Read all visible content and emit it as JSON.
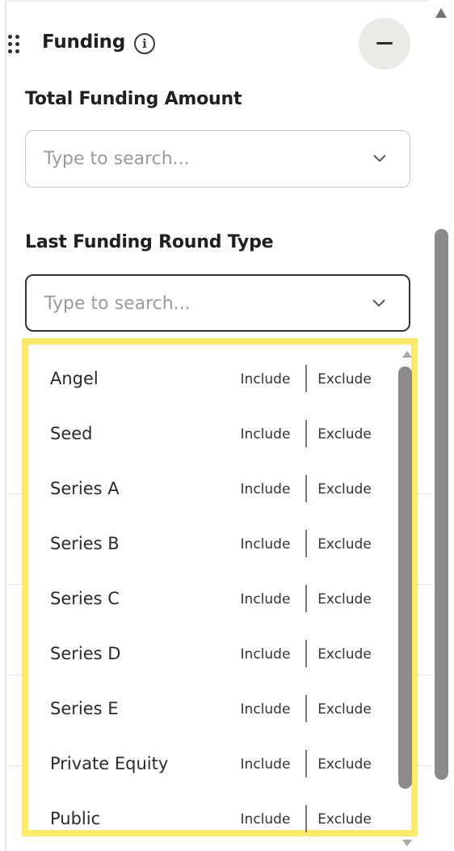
{
  "section": {
    "title": "Funding",
    "info_glyph": "i",
    "collapse_icon": "minus-icon"
  },
  "total_funding": {
    "label": "Total Funding Amount",
    "placeholder": "Type to search..."
  },
  "last_round": {
    "label": "Last Funding Round Type",
    "placeholder": "Type to search..."
  },
  "dropdown": {
    "highlight_color": "#fbe96b",
    "options": [
      {
        "label": "Angel",
        "include": "Include",
        "exclude": "Exclude"
      },
      {
        "label": "Seed",
        "include": "Include",
        "exclude": "Exclude"
      },
      {
        "label": "Series A",
        "include": "Include",
        "exclude": "Exclude"
      },
      {
        "label": "Series B",
        "include": "Include",
        "exclude": "Exclude"
      },
      {
        "label": "Series C",
        "include": "Include",
        "exclude": "Exclude"
      },
      {
        "label": "Series D",
        "include": "Include",
        "exclude": "Exclude"
      },
      {
        "label": "Series E",
        "include": "Include",
        "exclude": "Exclude"
      },
      {
        "label": "Private Equity",
        "include": "Include",
        "exclude": "Exclude"
      },
      {
        "label": "Public",
        "include": "Include",
        "exclude": "Exclude"
      }
    ]
  }
}
